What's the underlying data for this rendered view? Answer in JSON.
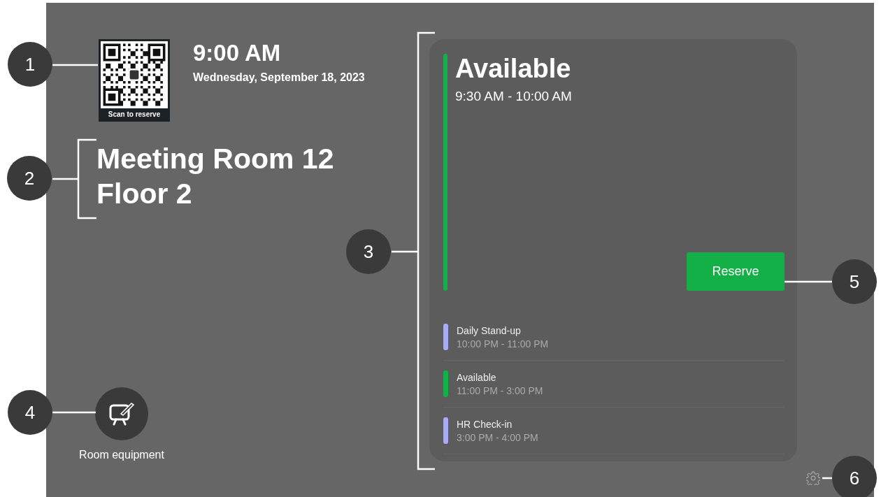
{
  "clock": {
    "time": "9:00 AM",
    "date": "Wednesday, September 18, 2023"
  },
  "qr": {
    "caption": "Scan to reserve"
  },
  "room": {
    "name": "Meeting Room 12",
    "floor": "Floor 2"
  },
  "equipment": {
    "label": "Room equipment"
  },
  "current": {
    "status": "Available",
    "time": "9:30 AM - 10:00 AM"
  },
  "reserve_button": "Reserve",
  "agenda": [
    {
      "title": "Daily Stand-up",
      "time": "10:00 PM - 11:00 PM",
      "color": "#a9acf5"
    },
    {
      "title": "Available",
      "time": "11:00 PM - 3:00 PM",
      "color": "#12b047"
    },
    {
      "title": "HR Check-in",
      "time": "3:00 PM - 4:00 PM",
      "color": "#a9acf5"
    }
  ],
  "callouts": [
    "1",
    "2",
    "3",
    "4",
    "5",
    "6"
  ]
}
